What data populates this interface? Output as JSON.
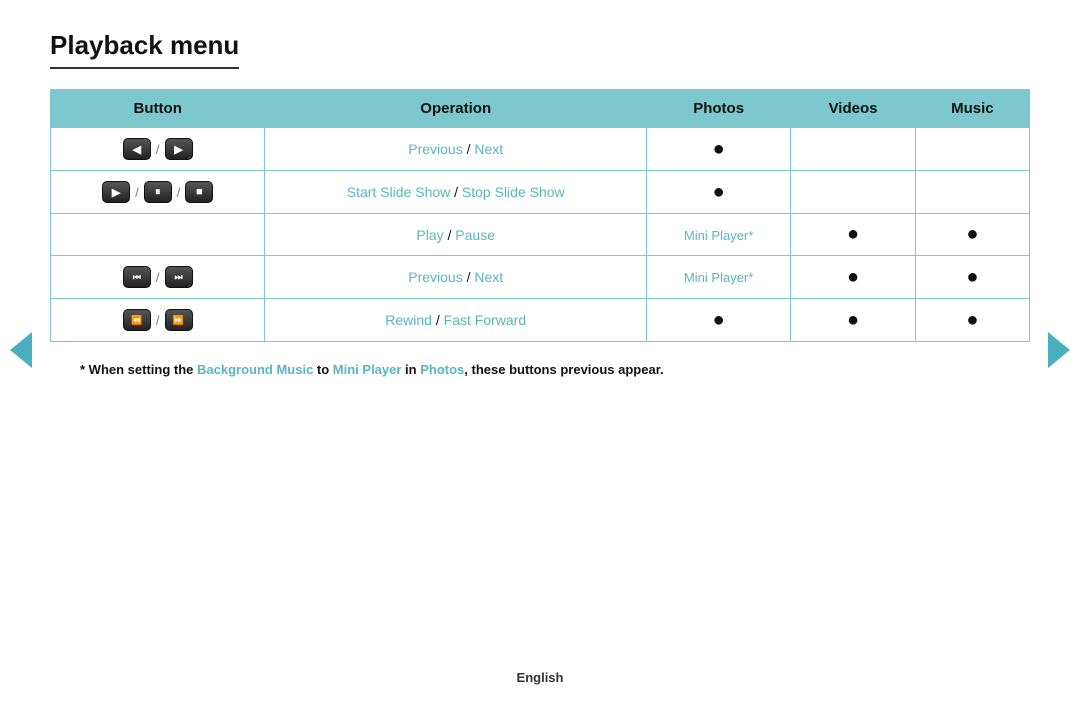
{
  "title": "Playback menu",
  "table": {
    "headers": [
      "Button",
      "Operation",
      "Photos",
      "Videos",
      "Music"
    ],
    "rows": [
      {
        "buttons": [
          {
            "icon": "◀",
            "type": "prev"
          },
          "/",
          {
            "icon": "▶",
            "type": "next"
          }
        ],
        "operation_parts": [
          {
            "text": "Previous",
            "colored": true
          },
          {
            "text": " / ",
            "colored": false
          },
          {
            "text": "Next",
            "colored": true
          }
        ],
        "photos": "bullet",
        "videos": "",
        "music": ""
      },
      {
        "buttons_special": "play_pause_stop",
        "operation_parts": [
          {
            "text": "Start Slide Show",
            "colored": true
          },
          {
            "text": " / ",
            "colored": false
          },
          {
            "text": "Stop Slide Show",
            "colored": true
          }
        ],
        "photos": "bullet",
        "videos": "",
        "music": ""
      },
      {
        "buttons": [],
        "operation_parts": [
          {
            "text": "Play",
            "colored": true
          },
          {
            "text": " / ",
            "colored": false
          },
          {
            "text": "Pause",
            "colored": true
          }
        ],
        "photos": "mini_player",
        "videos": "bullet",
        "music": "bullet"
      },
      {
        "buttons_special": "prev_next_skip",
        "operation_parts": [
          {
            "text": "Previous",
            "colored": true
          },
          {
            "text": " / ",
            "colored": false
          },
          {
            "text": "Next",
            "colored": true
          }
        ],
        "photos": "mini_player",
        "videos": "bullet",
        "music": "bullet"
      },
      {
        "buttons_special": "rewind_ff",
        "operation_parts": [
          {
            "text": "Rewind",
            "colored": true
          },
          {
            "text": " / ",
            "colored": false
          },
          {
            "text": "Fast Forward",
            "colored": true
          }
        ],
        "photos": "bullet",
        "videos": "bullet",
        "music": "bullet"
      }
    ]
  },
  "footnote": "* When setting the Background Music to Mini Player in Photos, these buttons previous appear.",
  "footnote_highlights": {
    "background_music": "Background Music",
    "mini_player": "Mini Player",
    "photos": "Photos"
  },
  "footer": {
    "language": "English"
  },
  "nav": {
    "left_label": "previous page",
    "right_label": "next page"
  }
}
